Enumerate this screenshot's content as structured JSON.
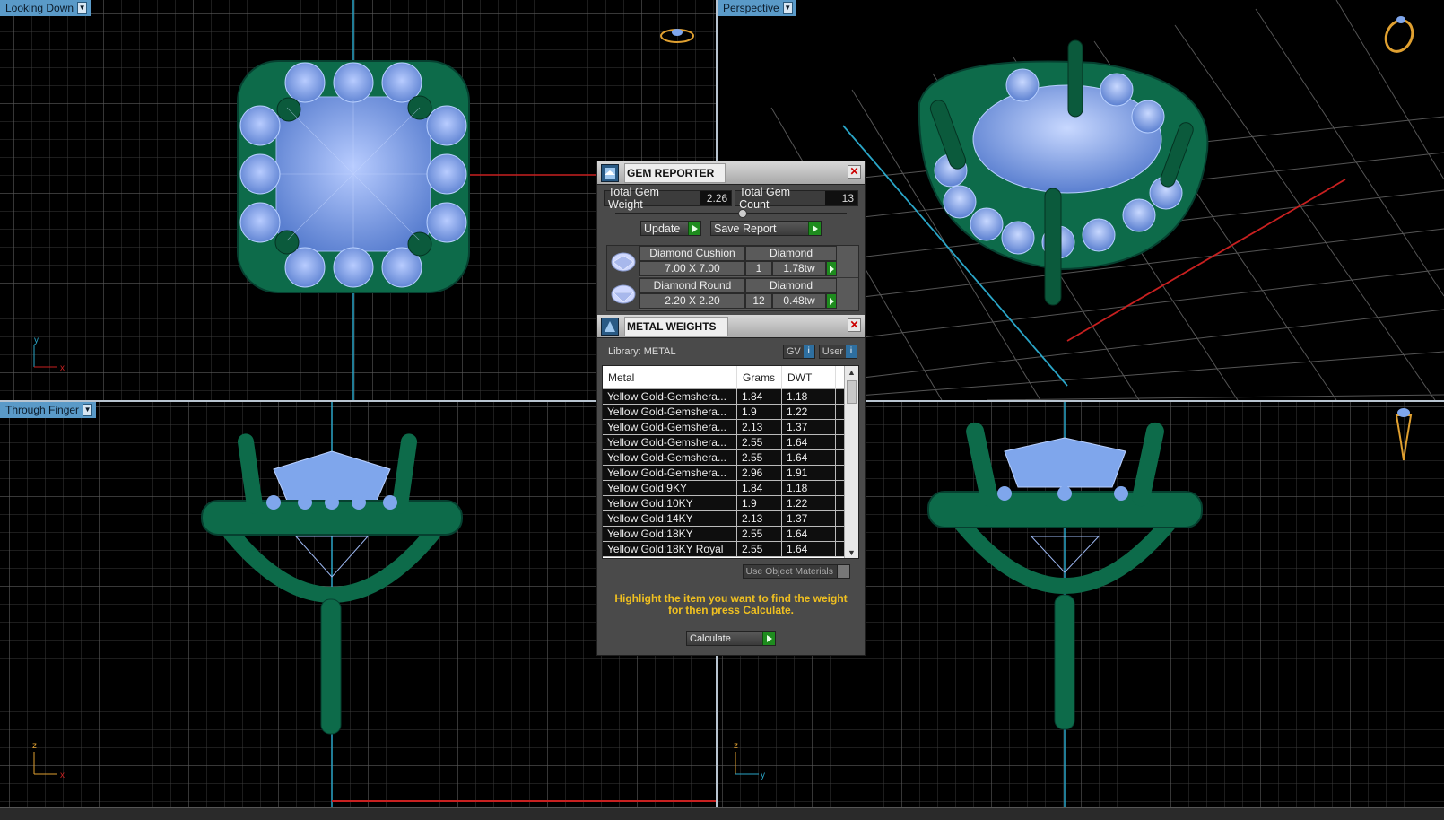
{
  "viewports": {
    "top_left": {
      "label": "Looking Down",
      "axis_a": "y",
      "axis_b": "x"
    },
    "top_right": {
      "label": "Perspective"
    },
    "bottom_left": {
      "label": "Through Finger",
      "axis_a": "z",
      "axis_b": "x"
    },
    "bottom_right": {
      "axis_a": "z",
      "axis_b": "y"
    }
  },
  "colors": {
    "grid": "#3a3a3a",
    "metal": "#0d6b4a",
    "gem": "#7fa6ec",
    "accent_label": "#5a9ac8",
    "hint_text": "#f0c020",
    "play_green": "#1e8c1e"
  },
  "gem_reporter": {
    "title": "GEM REPORTER",
    "total_gem_weight_label": "Total Gem Weight",
    "total_gem_weight_value": "2.26",
    "total_gem_count_label": "Total Gem Count",
    "total_gem_count_value": "13",
    "update_label": "Update",
    "save_report_label": "Save Report",
    "gems": [
      {
        "name": "Diamond Cushion",
        "type": "Diamond",
        "size": "7.00 X 7.00",
        "count": "1",
        "weight": "1.78tw"
      },
      {
        "name": "Diamond Round",
        "type": "Diamond",
        "size": "2.20 X 2.20",
        "count": "12",
        "weight": "0.48tw"
      }
    ]
  },
  "metal_weights": {
    "title": "METAL WEIGHTS",
    "library": "Library: METAL",
    "toggle_gv": "GV",
    "toggle_user": "User",
    "columns": [
      "Metal",
      "Grams",
      "DWT"
    ],
    "rows": [
      [
        "Yellow Gold-Gemshera...",
        "1.84",
        "1.18"
      ],
      [
        "Yellow Gold-Gemshera...",
        "1.9",
        "1.22"
      ],
      [
        "Yellow Gold-Gemshera...",
        "2.13",
        "1.37"
      ],
      [
        "Yellow Gold-Gemshera...",
        "2.55",
        "1.64"
      ],
      [
        "Yellow Gold-Gemshera...",
        "2.55",
        "1.64"
      ],
      [
        "Yellow Gold-Gemshera...",
        "2.96",
        "1.91"
      ],
      [
        "Yellow Gold:9KY",
        "1.84",
        "1.18"
      ],
      [
        "Yellow Gold:10KY",
        "1.9",
        "1.22"
      ],
      [
        "Yellow Gold:14KY",
        "2.13",
        "1.37"
      ],
      [
        "Yellow Gold:18KY",
        "2.55",
        "1.64"
      ],
      [
        "Yellow Gold:18KY Royal",
        "2.55",
        "1.64"
      ]
    ],
    "use_object_materials": "Use Object Materials",
    "hint": "Highlight the item you want to find the weight for then press Calculate.",
    "calculate_label": "Calculate"
  }
}
